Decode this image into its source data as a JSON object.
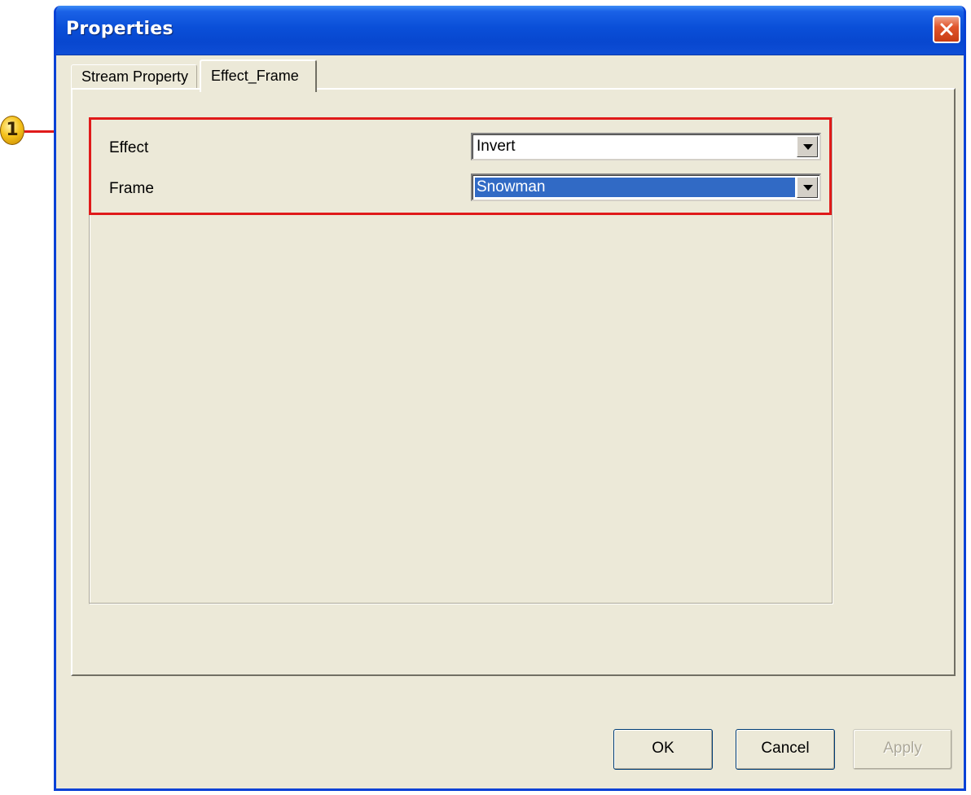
{
  "window": {
    "title": "Properties"
  },
  "tabs": [
    {
      "label": "Stream Property",
      "active": false
    },
    {
      "label": "Effect_Frame",
      "active": true
    }
  ],
  "callout": {
    "number": "1"
  },
  "fields": {
    "effect": {
      "label": "Effect",
      "value": "Invert"
    },
    "frame": {
      "label": "Frame",
      "value": "Snowman"
    }
  },
  "buttons": {
    "ok": "OK",
    "cancel": "Cancel",
    "apply": "Apply"
  },
  "colors": {
    "titlebar": "#0a4fd8",
    "dialog_bg": "#ece9d8",
    "highlight_border": "#e01a1a",
    "selection": "#316ac5"
  },
  "icons": {
    "close": "close-icon",
    "dropdown": "chevron-down-icon"
  }
}
